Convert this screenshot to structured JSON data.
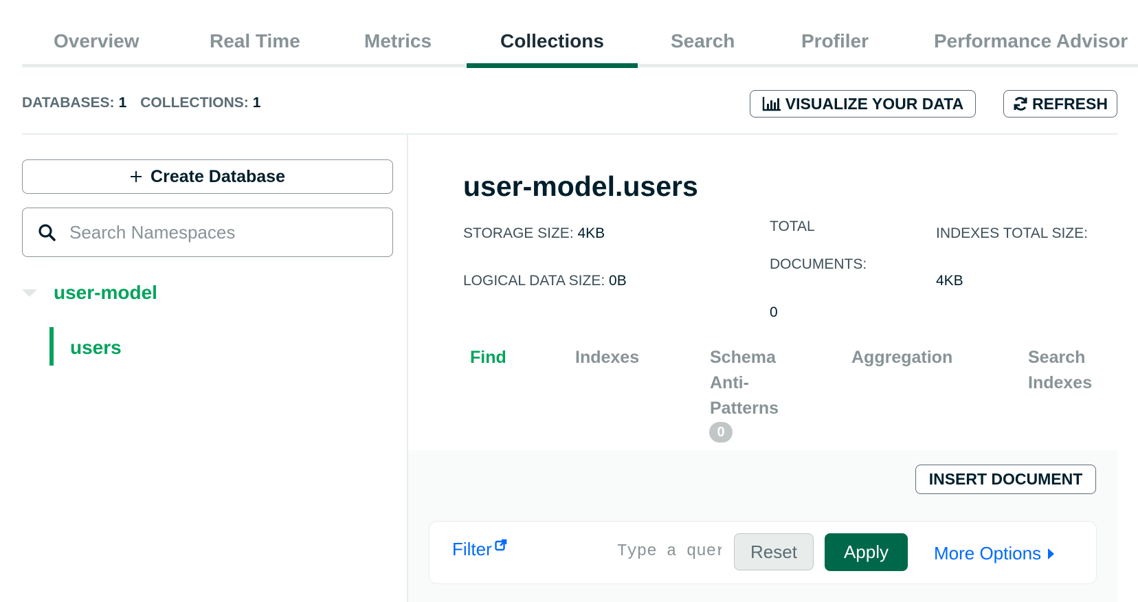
{
  "top_tabs": [
    "Overview",
    "Real Time",
    "Metrics",
    "Collections",
    "Search",
    "Profiler",
    "Performance Advisor"
  ],
  "active_top_tab": "Collections",
  "counts": {
    "databases_label": "DATABASES:",
    "databases_value": "1",
    "collections_label": "COLLECTIONS:",
    "collections_value": "1"
  },
  "actions": {
    "visualize_label": "VISUALIZE YOUR DATA",
    "refresh_label": "REFRESH"
  },
  "sidebar": {
    "create_db_label": "Create Database",
    "search_placeholder": "Search Namespaces",
    "database": "user-model",
    "collection": "users"
  },
  "namespace": {
    "title": "user-model.users",
    "storage_size_label": "STORAGE SIZE:",
    "storage_size_value": "4KB",
    "logical_size_label": "LOGICAL DATA SIZE:",
    "logical_size_value": "0B",
    "total_docs_label_1": "TOTAL",
    "total_docs_label_2": "DOCUMENTS:",
    "total_docs_value": "0",
    "indexes_size_label": "INDEXES TOTAL SIZE:",
    "indexes_size_value": "4KB"
  },
  "subtabs": {
    "find": "Find",
    "indexes": "Indexes",
    "schema_1": "Schema",
    "schema_2": "Anti-",
    "schema_3": "Patterns",
    "schema_badge": "0",
    "aggregation": "Aggregation",
    "search_1": "Search",
    "search_2": "Indexes",
    "active": "Find"
  },
  "query_bar": {
    "insert_label": "INSERT DOCUMENT",
    "filter_label": "Filter",
    "placeholder": "Type a query",
    "reset_label": "Reset",
    "apply_label": "Apply",
    "more_options_label": "More Options"
  },
  "colors": {
    "brand_green": "#00684a",
    "accent_green": "#00a35c",
    "link_blue": "#016bf8"
  }
}
